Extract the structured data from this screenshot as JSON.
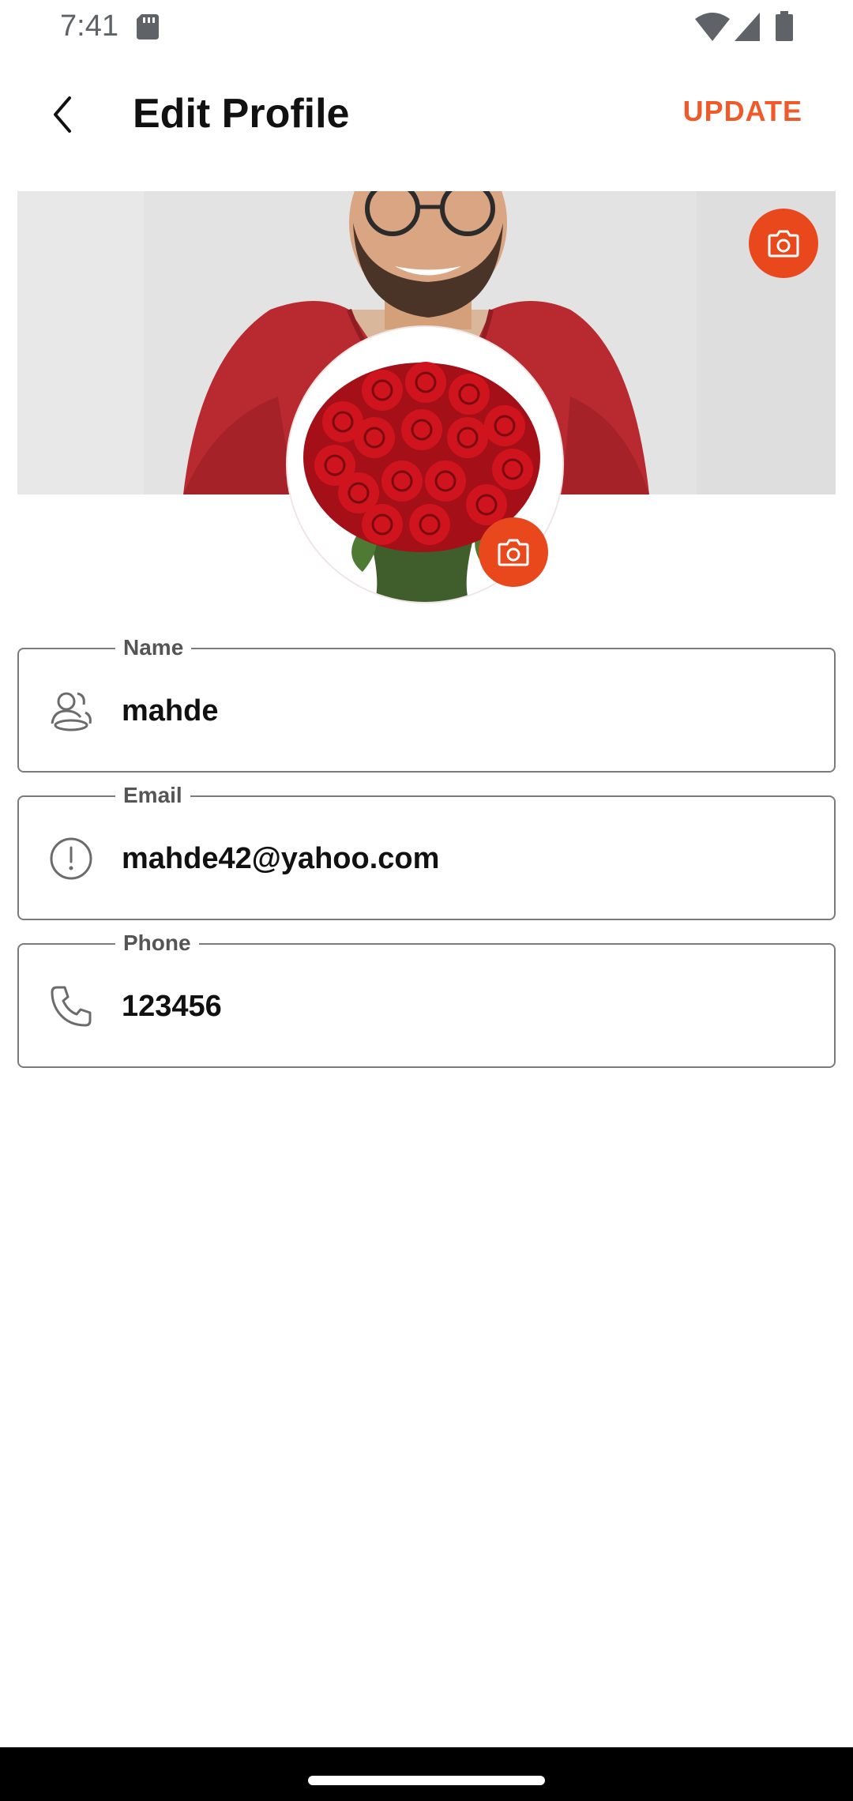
{
  "status_bar": {
    "time": "7:41"
  },
  "header": {
    "title": "Edit Profile",
    "update_label": "UPDATE",
    "back_icon": "chevron-left-icon"
  },
  "colors": {
    "accent": "#f0592a",
    "camera_button": "#e8481c",
    "border": "#7b7b7b"
  },
  "form": {
    "name": {
      "label": "Name",
      "value": "mahde",
      "icon": "users-icon"
    },
    "email": {
      "label": "Email",
      "value": "mahde42@yahoo.com",
      "icon": "alert-circle-icon"
    },
    "phone": {
      "label": "Phone",
      "value": "123456",
      "icon": "phone-icon"
    }
  }
}
